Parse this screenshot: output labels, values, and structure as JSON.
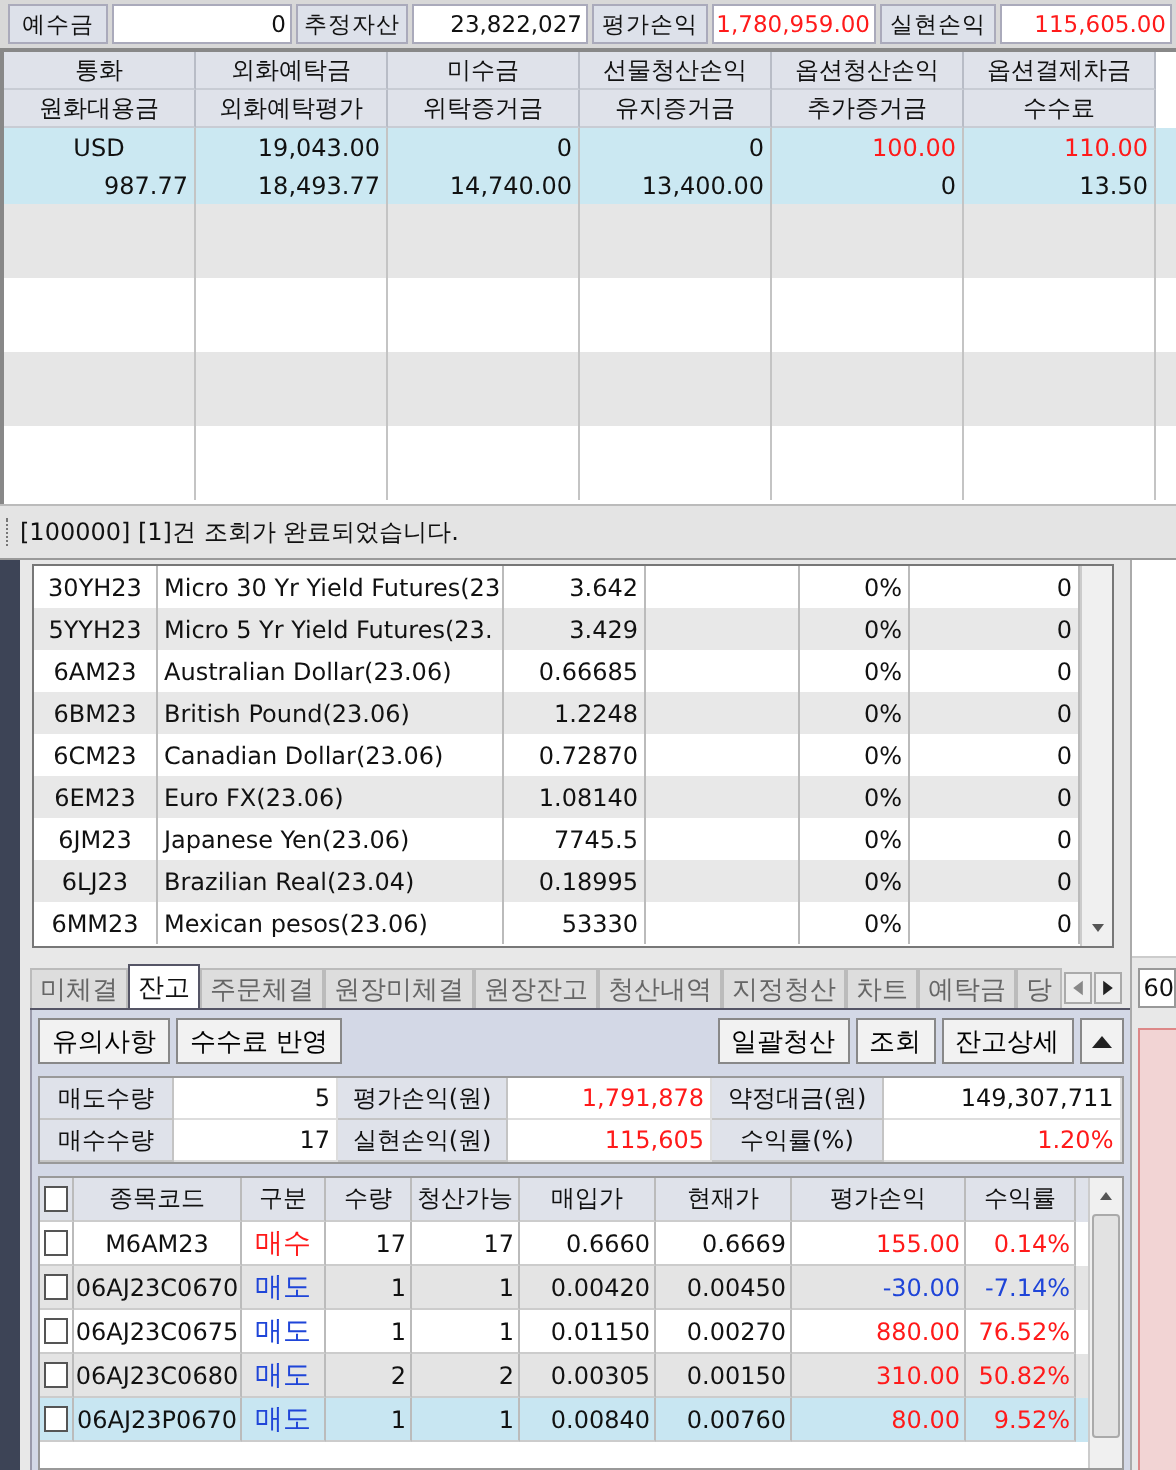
{
  "top_summary": [
    {
      "label": "예수금",
      "value": "0"
    },
    {
      "label": "추정자산",
      "value": "23,822,027"
    },
    {
      "label": "평가손익",
      "value": "1,780,959.00",
      "color": "#ff1a1a"
    },
    {
      "label": "실현손익",
      "value": "115,605.00",
      "color": "#ff1a1a"
    }
  ],
  "deposit_table": {
    "header_rows": [
      [
        "통화",
        "외화예탁금",
        "미수금",
        "선물청산손익",
        "옵션청산손익",
        "옵션결제차금"
      ],
      [
        "원화대용금",
        "외화예탁평가",
        "위탁증거금",
        "유지증거금",
        "추가증거금",
        "수수료"
      ]
    ],
    "records": [
      {
        "selected": true,
        "lines": [
          [
            {
              "text": "USD"
            },
            {
              "text": "19,043.00"
            },
            {
              "text": "0"
            },
            {
              "text": "0"
            },
            {
              "text": "100.00",
              "color": "#ff1a1a"
            },
            {
              "text": "110.00",
              "color": "#ff1a1a"
            }
          ],
          [
            {
              "text": "987.77"
            },
            {
              "text": "18,493.77"
            },
            {
              "text": "14,740.00"
            },
            {
              "text": "13,400.00"
            },
            {
              "text": "0"
            },
            {
              "text": "13.50"
            }
          ]
        ]
      }
    ]
  },
  "status_bar": "[100000] [1]건 조회가 완료되었습니다.",
  "instruments": [
    {
      "code": "30YH23",
      "name": "Micro 30 Yr Yield Futures(23",
      "price": "3.642",
      "pct": "0%",
      "qty": "0"
    },
    {
      "code": "5YYH23",
      "name": "Micro 5 Yr Yield Futures(23.",
      "price": "3.429",
      "pct": "0%",
      "qty": "0"
    },
    {
      "code": "6AM23",
      "name": "Australian Dollar(23.06)",
      "price": "0.66685",
      "pct": "0%",
      "qty": "0"
    },
    {
      "code": "6BM23",
      "name": "British Pound(23.06)",
      "price": "1.2248",
      "pct": "0%",
      "qty": "0"
    },
    {
      "code": "6CM23",
      "name": "Canadian Dollar(23.06)",
      "price": "0.72870",
      "pct": "0%",
      "qty": "0"
    },
    {
      "code": "6EM23",
      "name": "Euro FX(23.06)",
      "price": "1.08140",
      "pct": "0%",
      "qty": "0"
    },
    {
      "code": "6JM23",
      "name": "Japanese Yen(23.06)",
      "price": "7745.5",
      "pct": "0%",
      "qty": "0"
    },
    {
      "code": "6LJ23",
      "name": "Brazilian Real(23.04)",
      "price": "0.18995",
      "pct": "0%",
      "qty": "0"
    },
    {
      "code": "6MM23",
      "name": "Mexican pesos(23.06)",
      "price": "53330",
      "pct": "0%",
      "qty": "0"
    }
  ],
  "tabs": [
    {
      "label": "미체결",
      "selected": false
    },
    {
      "label": "잔고",
      "selected": true
    },
    {
      "label": "주문체결",
      "selected": false
    },
    {
      "label": "원장미체결",
      "selected": false
    },
    {
      "label": "원장잔고",
      "selected": false
    },
    {
      "label": "청산내역",
      "selected": false
    },
    {
      "label": "지정청산",
      "selected": false
    },
    {
      "label": "차트",
      "selected": false
    },
    {
      "label": "예탁금",
      "selected": false
    },
    {
      "label": "당",
      "selected": false
    }
  ],
  "side_field": {
    "value": "60"
  },
  "buttons_left": [
    "유의사항",
    "수수료 반영"
  ],
  "buttons_right": [
    "일괄청산",
    "조회",
    "잔고상세"
  ],
  "balance_summary": [
    [
      {
        "label": "매도수량",
        "value": "5"
      },
      {
        "label": "평가손익(원)",
        "value": "1,791,878",
        "color": "#ff1a1a"
      },
      {
        "label": "약정대금(원)",
        "value": "149,307,711"
      }
    ],
    [
      {
        "label": "매수수량",
        "value": "17"
      },
      {
        "label": "실현손익(원)",
        "value": "115,605",
        "color": "#ff1a1a"
      },
      {
        "label": "수익률(%)",
        "value": "1.20%",
        "color": "#ff1a1a"
      }
    ]
  ],
  "positions": {
    "header_checked": false,
    "columns": [
      "종목코드",
      "구분",
      "수량",
      "청산가능",
      "매입가",
      "현재가",
      "평가손익",
      "수익률"
    ],
    "rows": [
      {
        "checked": false,
        "selected": false,
        "cells": [
          {
            "text": "M6AM23"
          },
          {
            "text": "매수",
            "color": "#ff1a1a"
          },
          {
            "text": "17"
          },
          {
            "text": "17"
          },
          {
            "text": "0.6660"
          },
          {
            "text": "0.6669"
          },
          {
            "text": "155.00",
            "color": "#ff1a1a"
          },
          {
            "text": "0.14%",
            "color": "#ff1a1a"
          }
        ]
      },
      {
        "checked": false,
        "selected": false,
        "cells": [
          {
            "text": "06AJ23C0670"
          },
          {
            "text": "매도",
            "color": "#1f45d8"
          },
          {
            "text": "1"
          },
          {
            "text": "1"
          },
          {
            "text": "0.00420"
          },
          {
            "text": "0.00450"
          },
          {
            "text": "-30.00",
            "color": "#1f45d8"
          },
          {
            "text": "-7.14%",
            "color": "#1f45d8"
          }
        ]
      },
      {
        "checked": false,
        "selected": false,
        "cells": [
          {
            "text": "06AJ23C0675"
          },
          {
            "text": "매도",
            "color": "#1f45d8"
          },
          {
            "text": "1"
          },
          {
            "text": "1"
          },
          {
            "text": "0.01150"
          },
          {
            "text": "0.00270"
          },
          {
            "text": "880.00",
            "color": "#ff1a1a"
          },
          {
            "text": "76.52%",
            "color": "#ff1a1a"
          }
        ]
      },
      {
        "checked": false,
        "selected": false,
        "cells": [
          {
            "text": "06AJ23C0680"
          },
          {
            "text": "매도",
            "color": "#1f45d8"
          },
          {
            "text": "2"
          },
          {
            "text": "2"
          },
          {
            "text": "0.00305"
          },
          {
            "text": "0.00150"
          },
          {
            "text": "310.00",
            "color": "#ff1a1a"
          },
          {
            "text": "50.82%",
            "color": "#ff1a1a"
          }
        ]
      },
      {
        "checked": false,
        "selected": true,
        "cells": [
          {
            "text": "06AJ23P0670"
          },
          {
            "text": "매도",
            "color": "#1f45d8"
          },
          {
            "text": "1"
          },
          {
            "text": "1"
          },
          {
            "text": "0.00840"
          },
          {
            "text": "0.00760"
          },
          {
            "text": "80.00",
            "color": "#ff1a1a"
          },
          {
            "text": "9.52%",
            "color": "#ff1a1a"
          }
        ]
      }
    ]
  }
}
